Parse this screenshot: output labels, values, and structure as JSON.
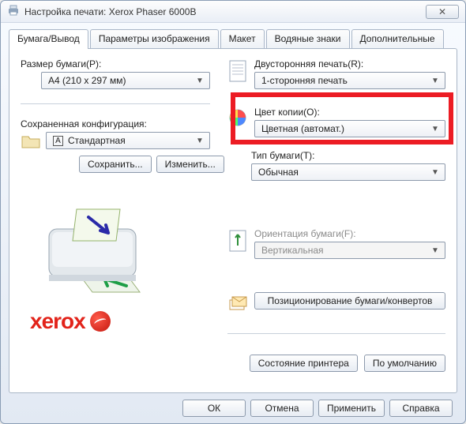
{
  "window": {
    "title": "Настройка печати: Xerox Phaser 6000B"
  },
  "tabs": {
    "paper_output": "Бумага/Вывод",
    "image_params": "Параметры изображения",
    "layout": "Макет",
    "watermarks": "Водяные знаки",
    "advanced": "Дополнительные"
  },
  "paper_size": {
    "label": "Размер бумаги(P):",
    "value": "A4 (210 x 297 мм)"
  },
  "saved_config": {
    "label": "Сохраненная конфигурация:",
    "value": "Стандартная"
  },
  "buttons": {
    "save": "Сохранить...",
    "edit": "Изменить...",
    "position_paper": "Позиционирование бумаги/конвертов",
    "printer_status": "Состояние принтера",
    "defaults": "По умолчанию",
    "ok": "ОК",
    "cancel": "Отмена",
    "apply": "Применить",
    "help": "Справка"
  },
  "duplex": {
    "label": "Двусторонняя печать(R):",
    "value": "1-сторонняя печать"
  },
  "color": {
    "label": "Цвет копии(O):",
    "value": "Цветная (автомат.)"
  },
  "paper_type": {
    "label": "Тип бумаги(T):",
    "value": "Обычная"
  },
  "orientation": {
    "label": "Ориентация бумаги(F):",
    "value": "Вертикальная"
  },
  "brand": {
    "word": "xerox"
  }
}
